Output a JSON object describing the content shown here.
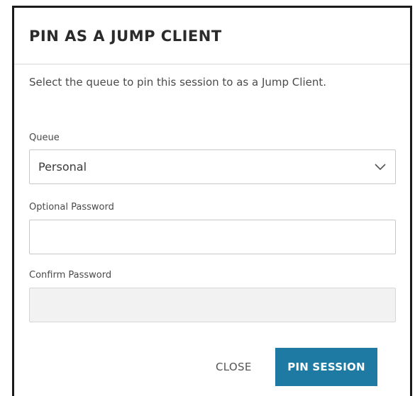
{
  "dialog": {
    "title": "PIN AS A JUMP CLIENT",
    "description": "Select the queue to pin this session to as a Jump Client.",
    "queue": {
      "label": "Queue",
      "selected": "Personal"
    },
    "optional_password": {
      "label": "Optional Password",
      "value": ""
    },
    "confirm_password": {
      "label": "Confirm Password",
      "value": ""
    },
    "buttons": {
      "close_label": "CLOSE",
      "pin_label": "PIN SESSION"
    }
  },
  "colors": {
    "primary": "#1f7aa3",
    "border": "#c8c8c8",
    "disabled_bg": "#f2f2f2",
    "text": "#333333"
  },
  "icons": {
    "dropdown": "chevron-down-icon"
  }
}
